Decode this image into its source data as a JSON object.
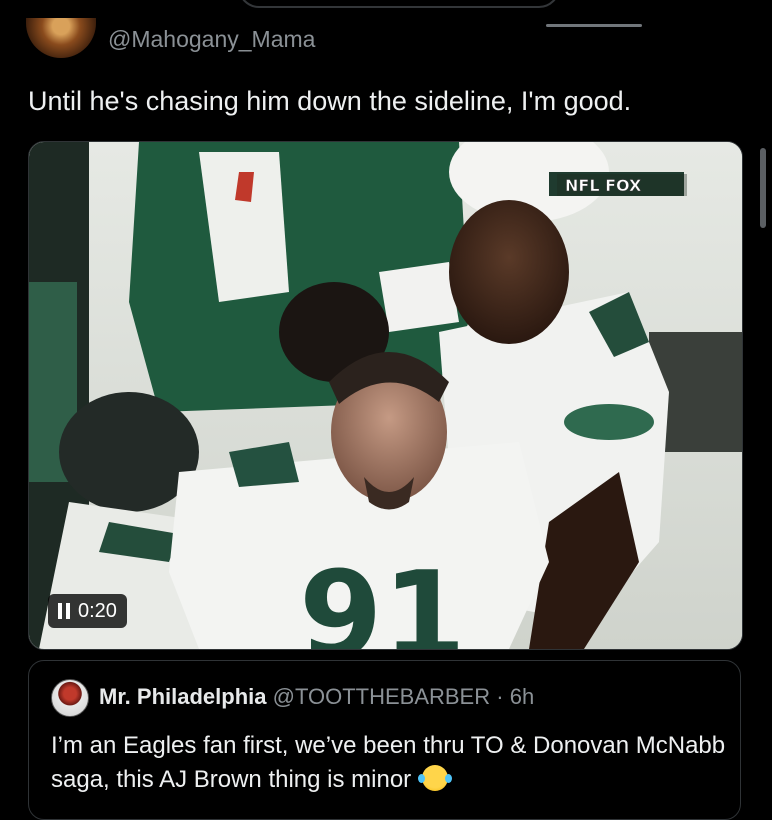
{
  "tweet": {
    "handle": "@Mahogany_Mama",
    "text": "Until he's chasing him down the sideline, I'm good.",
    "video": {
      "time": "0:20",
      "overlay_logo": "NFL FOX",
      "jersey_number": "91"
    }
  },
  "quote": {
    "name": "Mr. Philadelphia",
    "handle": "@TOOTTHEBARBER",
    "separator": "·",
    "age": "6h",
    "text": "I’m an Eagles fan first, we’ve been thru TO & Donovan McNabb saga, this AJ Brown thing is minor",
    "emoji": "face-with-tears-of-joy"
  },
  "colors": {
    "background": "#000000",
    "text": "#e7e9ea",
    "muted": "#8b9196",
    "border": "#2f3336"
  }
}
